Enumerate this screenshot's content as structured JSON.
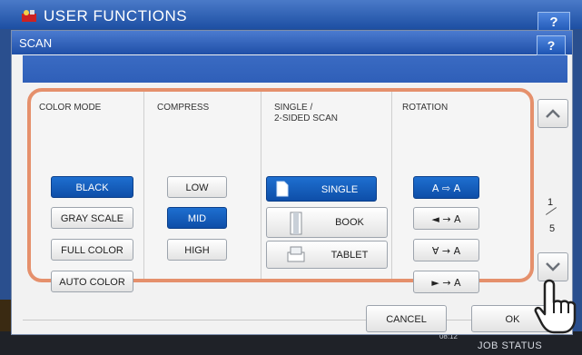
{
  "background_window": {
    "title": "USER FUNCTIONS",
    "help_label": "?",
    "datetime_line1": "",
    "datetime_line2": "08:12",
    "job_status_label": "JOB STATUS"
  },
  "dialog": {
    "title": "SCAN",
    "help_label": "?"
  },
  "columns": {
    "color_mode": {
      "heading": "COLOR MODE",
      "options": [
        "BLACK",
        "GRAY SCALE",
        "FULL COLOR",
        "AUTO COLOR"
      ],
      "selected": "BLACK"
    },
    "compress": {
      "heading": "COMPRESS",
      "options": [
        "LOW",
        "MID",
        "HIGH"
      ],
      "selected": "MID"
    },
    "sided_scan": {
      "heading_line1": "SINGLE /",
      "heading_line2": "2-SIDED SCAN",
      "options": [
        "SINGLE",
        "BOOK",
        "TABLET"
      ],
      "selected": "SINGLE"
    },
    "rotation": {
      "heading": "ROTATION",
      "options": [
        {
          "icon": "rotation-none-icon",
          "glyph": "A ⇨ A"
        },
        {
          "icon": "rotation-90-cw-icon",
          "glyph": "◄ → A"
        },
        {
          "icon": "rotation-180-icon",
          "glyph": "∀ → A"
        },
        {
          "icon": "rotation-90-ccw-icon",
          "glyph": "► → A"
        }
      ],
      "selected_index": 0
    }
  },
  "pagination": {
    "current": "1",
    "total": "5"
  },
  "footer": {
    "cancel_label": "CANCEL",
    "ok_label": "OK"
  },
  "colors": {
    "accent_blue": "#1e6fd0",
    "panel_border": "#e5906c",
    "titlebar_blue": "#1f4fa7"
  }
}
